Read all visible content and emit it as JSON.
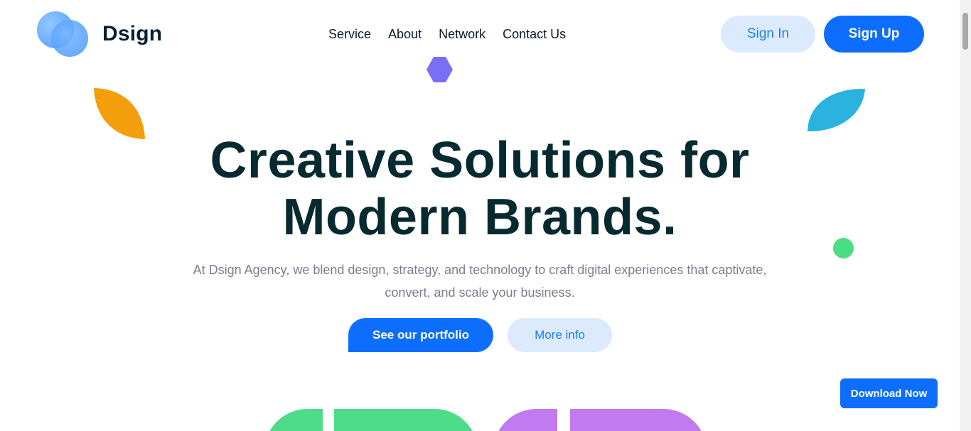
{
  "brand": {
    "name": "Dsign"
  },
  "nav": {
    "items": [
      {
        "label": "Service"
      },
      {
        "label": "About"
      },
      {
        "label": "Network"
      },
      {
        "label": "Contact Us"
      }
    ]
  },
  "auth": {
    "signin_label": "Sign In",
    "signup_label": "Sign Up"
  },
  "hero": {
    "title_line1": "Creative Solutions for",
    "title_line2": "Modern Brands.",
    "subtitle": "At Dsign Agency, we blend design, strategy, and technology to craft digital experiences that captivate, convert, and scale your business.",
    "primary_cta": "See our portfolio",
    "secondary_cta": "More info"
  },
  "floating": {
    "download_label": "Download Now"
  },
  "colors": {
    "primary": "#0d6efd",
    "primary_soft": "#dbeafd",
    "heading": "#062a30",
    "muted_text": "#7a7e8f",
    "decor_orange": "#f59e0b",
    "decor_blue": "#2bb3e0",
    "decor_purple": "#7b6ef6",
    "decor_green": "#4ade80",
    "blob_green": "#4fdc8a",
    "blob_purple": "#c27af0"
  },
  "icons": {
    "logo": "overlapping-circles-logo-icon",
    "hexagon": "hexagon-decor-icon",
    "leaf_orange": "leaf-decor-icon",
    "leaf_blue": "leaf-decor-icon",
    "dot_green": "dot-decor-icon"
  }
}
